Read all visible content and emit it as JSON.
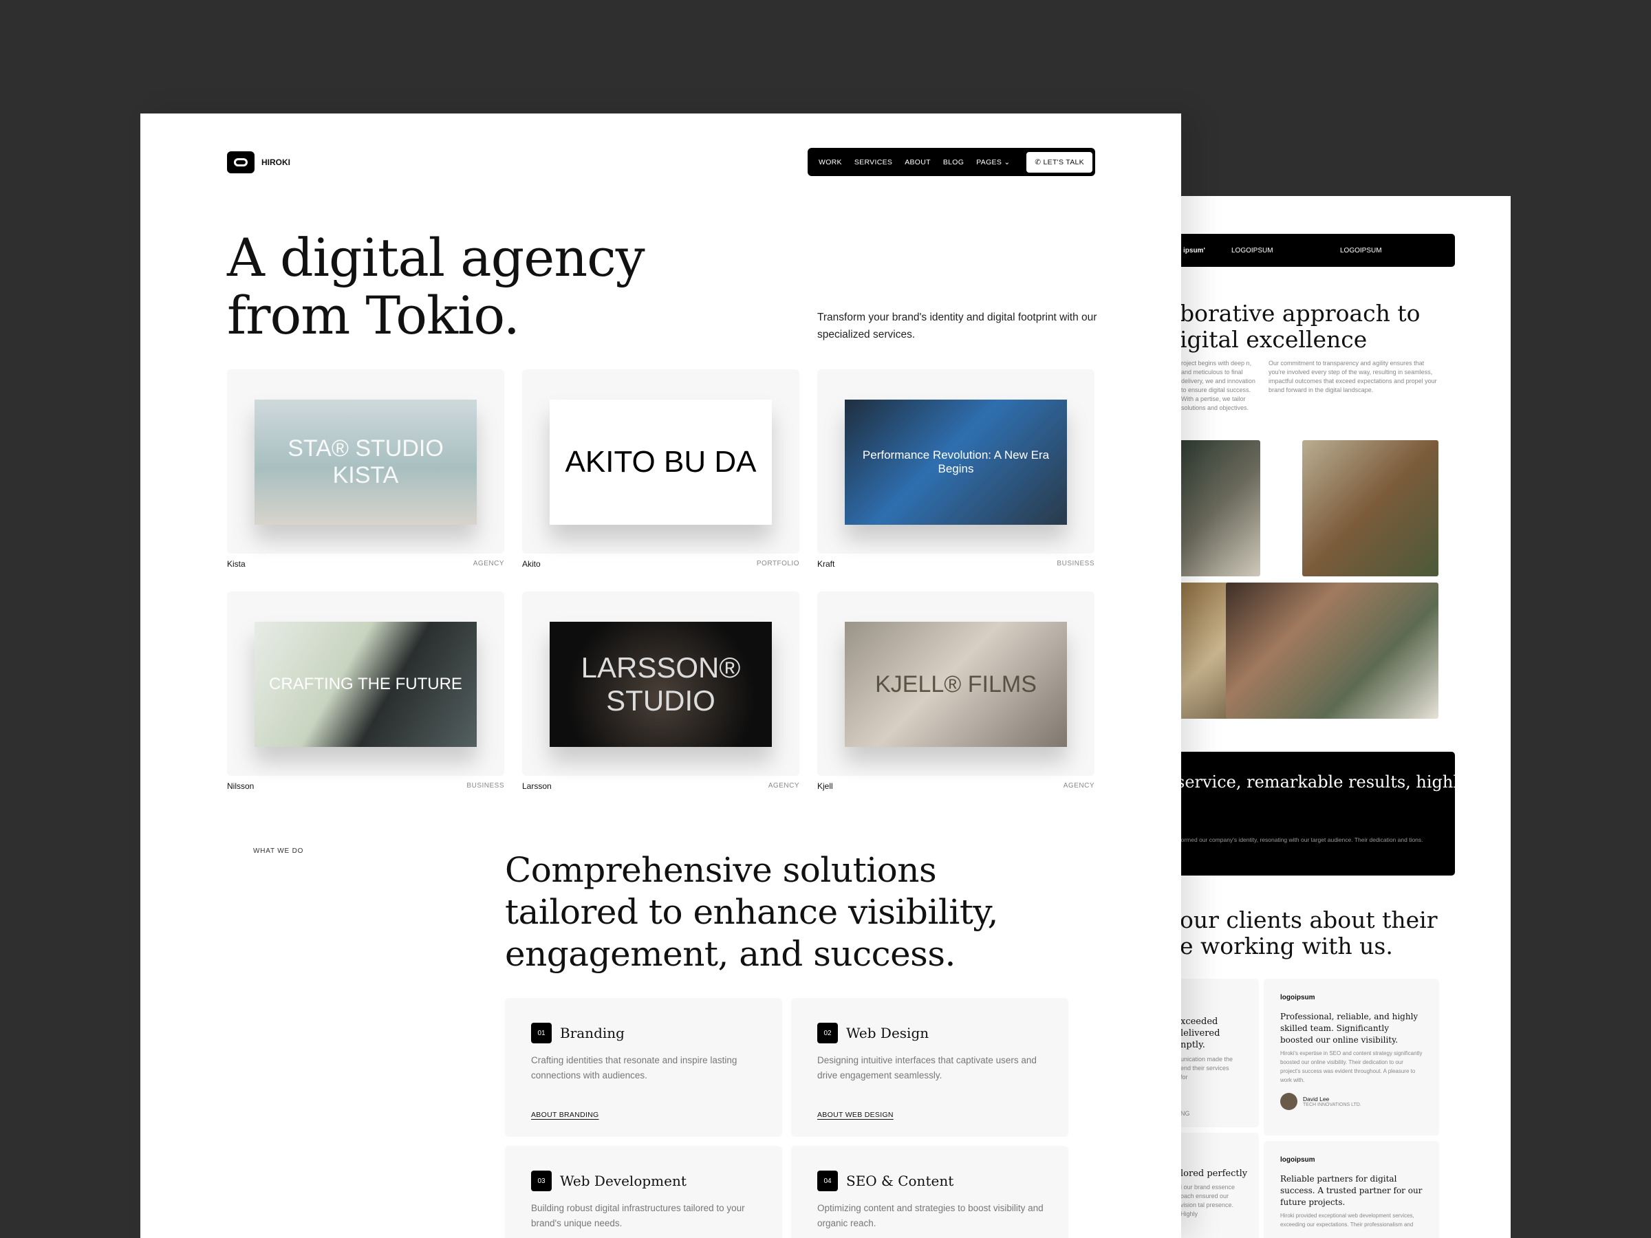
{
  "brand": {
    "name": "HIROKI"
  },
  "nav": {
    "items": [
      "WORK",
      "SERVICES",
      "ABOUT",
      "BLOG",
      "PAGES"
    ],
    "cta": "LET'S TALK",
    "phone_icon": "phone-icon",
    "chevron": "chevron-down-icon"
  },
  "hero": {
    "line1": "A digital agency",
    "line2": "from Tokio.",
    "subtitle": "Transform your brand's identity and digital footprint with our specialized services."
  },
  "projects": [
    {
      "name": "Kista",
      "tag": "AGENCY",
      "preview": "STA® STUDIO KISTA"
    },
    {
      "name": "Akito",
      "tag": "PORTFOLIO",
      "preview": "AKITO BU DA"
    },
    {
      "name": "Kraft",
      "tag": "BUSINESS",
      "preview": "Performance Revolution: A New Era Begins"
    },
    {
      "name": "Nilsson",
      "tag": "BUSINESS",
      "preview": "CRAFTING THE FUTURE"
    },
    {
      "name": "Larsson",
      "tag": "AGENCY",
      "preview": "LARSSON® STUDIO"
    },
    {
      "name": "Kjell",
      "tag": "AGENCY",
      "preview": "KJELL® FILMS"
    }
  ],
  "services": {
    "label": "WHAT WE DO",
    "heading": "Comprehensive solutions tailored to enhance visibility, engagement, and success.",
    "items": [
      {
        "num": "01",
        "title": "Branding",
        "desc": "Crafting identities that resonate and inspire lasting connections with audiences.",
        "link": "ABOUT BRANDING"
      },
      {
        "num": "02",
        "title": "Web Design",
        "desc": "Designing intuitive interfaces that captivate users and drive engagement seamlessly.",
        "link": "ABOUT WEB DESIGN"
      },
      {
        "num": "03",
        "title": "Web Development",
        "desc": "Building robust digital infrastructures tailored to your brand's unique needs."
      },
      {
        "num": "04",
        "title": "SEO & Content",
        "desc": "Optimizing content and strategies to boost visibility and organic reach."
      }
    ]
  },
  "back": {
    "logos": [
      "ipsum'",
      "LOGOIPSUM",
      "LOGOIPSUM"
    ],
    "heading1": "borative approach to",
    "heading2": "igital excellence",
    "text_left": "roject begins with deep n, and meticulous to final delivery, we and innovation to ensure digital success. With a pertise, we tailor solutions and objectives.",
    "text_right": "Our commitment to transparency and agility ensures that you're involved every step of the way, resulting in seamless, impactful outcomes that exceed expectations and propel your brand forward in the digital landscape.",
    "quote": "service, remarkable results, highly led. A top choice for digital",
    "quote_text": "sformed our company's identity, resonating with our target audience. Their dedication and tions.",
    "clients_heading1": "our clients about their",
    "clients_heading2": "e working with us.",
    "testimonials": [
      {
        "title": "xceeded lelivered nptly.",
        "text": "unication made the end their services for",
        "company": "NG"
      },
      {
        "logo": "logoipsum",
        "title": "Professional, reliable, and highly skilled team. Significantly boosted our online visibility.",
        "text": "Hiroki's expertise in SEO and content strategy significantly boosted our online visibility. Their dedication to our project's success was evident throughout. A pleasure to work with.",
        "author": "David Lee",
        "company": "TECH INNOVATIONS LTD."
      },
      {
        "title": "lored perfectly",
        "text": "l our brand essence oach ensured our vision tal presence. Highly"
      },
      {
        "logo": "logoipsum",
        "title": "Reliable partners for digital success. A trusted partner for our future projects.",
        "text": "Hiroki provided exceptional web development services, exceeding our expectations. Their professionalism and"
      }
    ]
  }
}
